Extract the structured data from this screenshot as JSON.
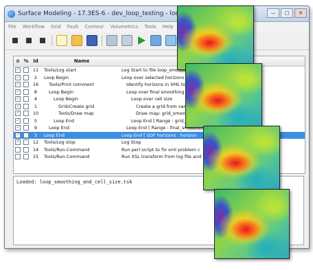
{
  "window": {
    "title": "Surface Modeling - 17.3ES-6 - dev_loop_testing - loop_smoothing_",
    "buttons": [
      "—",
      "□",
      "✕"
    ]
  },
  "menu": [
    "File",
    "Workflow",
    "Grid",
    "Fault",
    "Contour",
    "Volumetrics",
    "Tools",
    "Help"
  ],
  "table": {
    "headers": {
      "check": "⊘",
      "skip": "%",
      "id": "Id",
      "name": "Name",
      "description": "D"
    },
    "rows": [
      {
        "checked": true,
        "id": "11",
        "name": "Tools/Log start",
        "indent": 0,
        "desc": "Log Start to file loop_smoothin"
      },
      {
        "checked": true,
        "id": "2",
        "name": "Loop Begin",
        "indent": 0,
        "desc": "Loop over selected horizons"
      },
      {
        "checked": true,
        "id": "16",
        "name": "Tools/Print comment",
        "indent": 1,
        "desc": "Identify horizons in XML log"
      },
      {
        "checked": true,
        "id": "8",
        "name": "Loop Begin",
        "indent": 1,
        "desc": "Loop over final smoothing passes"
      },
      {
        "checked": true,
        "id": "4",
        "name": "Loop Begin",
        "indent": 2,
        "desc": "Loop over cell size"
      },
      {
        "checked": true,
        "id": "1",
        "name": "Grid/Create grid",
        "indent": 3,
        "desc": "Create a grid from various input da"
      },
      {
        "checked": true,
        "id": "10",
        "name": "Tools/Draw map",
        "indent": 3,
        "desc": "Draw map: grid_smoothing_demo."
      },
      {
        "checked": true,
        "id": "5",
        "name": "Loop End",
        "indent": 2,
        "desc": "Loop End [ Range : grid_cell ]"
      },
      {
        "checked": true,
        "id": "9",
        "name": "Loop End",
        "indent": 1,
        "desc": "Loop End [ Range : final_smoothin"
      },
      {
        "checked": true,
        "id": "3",
        "name": "Loop End",
        "indent": 0,
        "desc": "Loop End [ SDF horizons : horizon",
        "selected": true
      },
      {
        "checked": true,
        "id": "12",
        "name": "Tools/Log stop",
        "indent": 0,
        "desc": "Log Stop"
      },
      {
        "checked": false,
        "id": "14",
        "name": "Tools/Run-Command",
        "indent": 0,
        "desc": "Run perl script to fix xml problem c"
      },
      {
        "checked": false,
        "id": "15",
        "name": "Tools/Run-Command",
        "indent": 0,
        "desc": "Run XSL transform from log file and"
      }
    ]
  },
  "log": {
    "text": "Loaded: loop_smoothing_and_cell_size.tsk"
  }
}
